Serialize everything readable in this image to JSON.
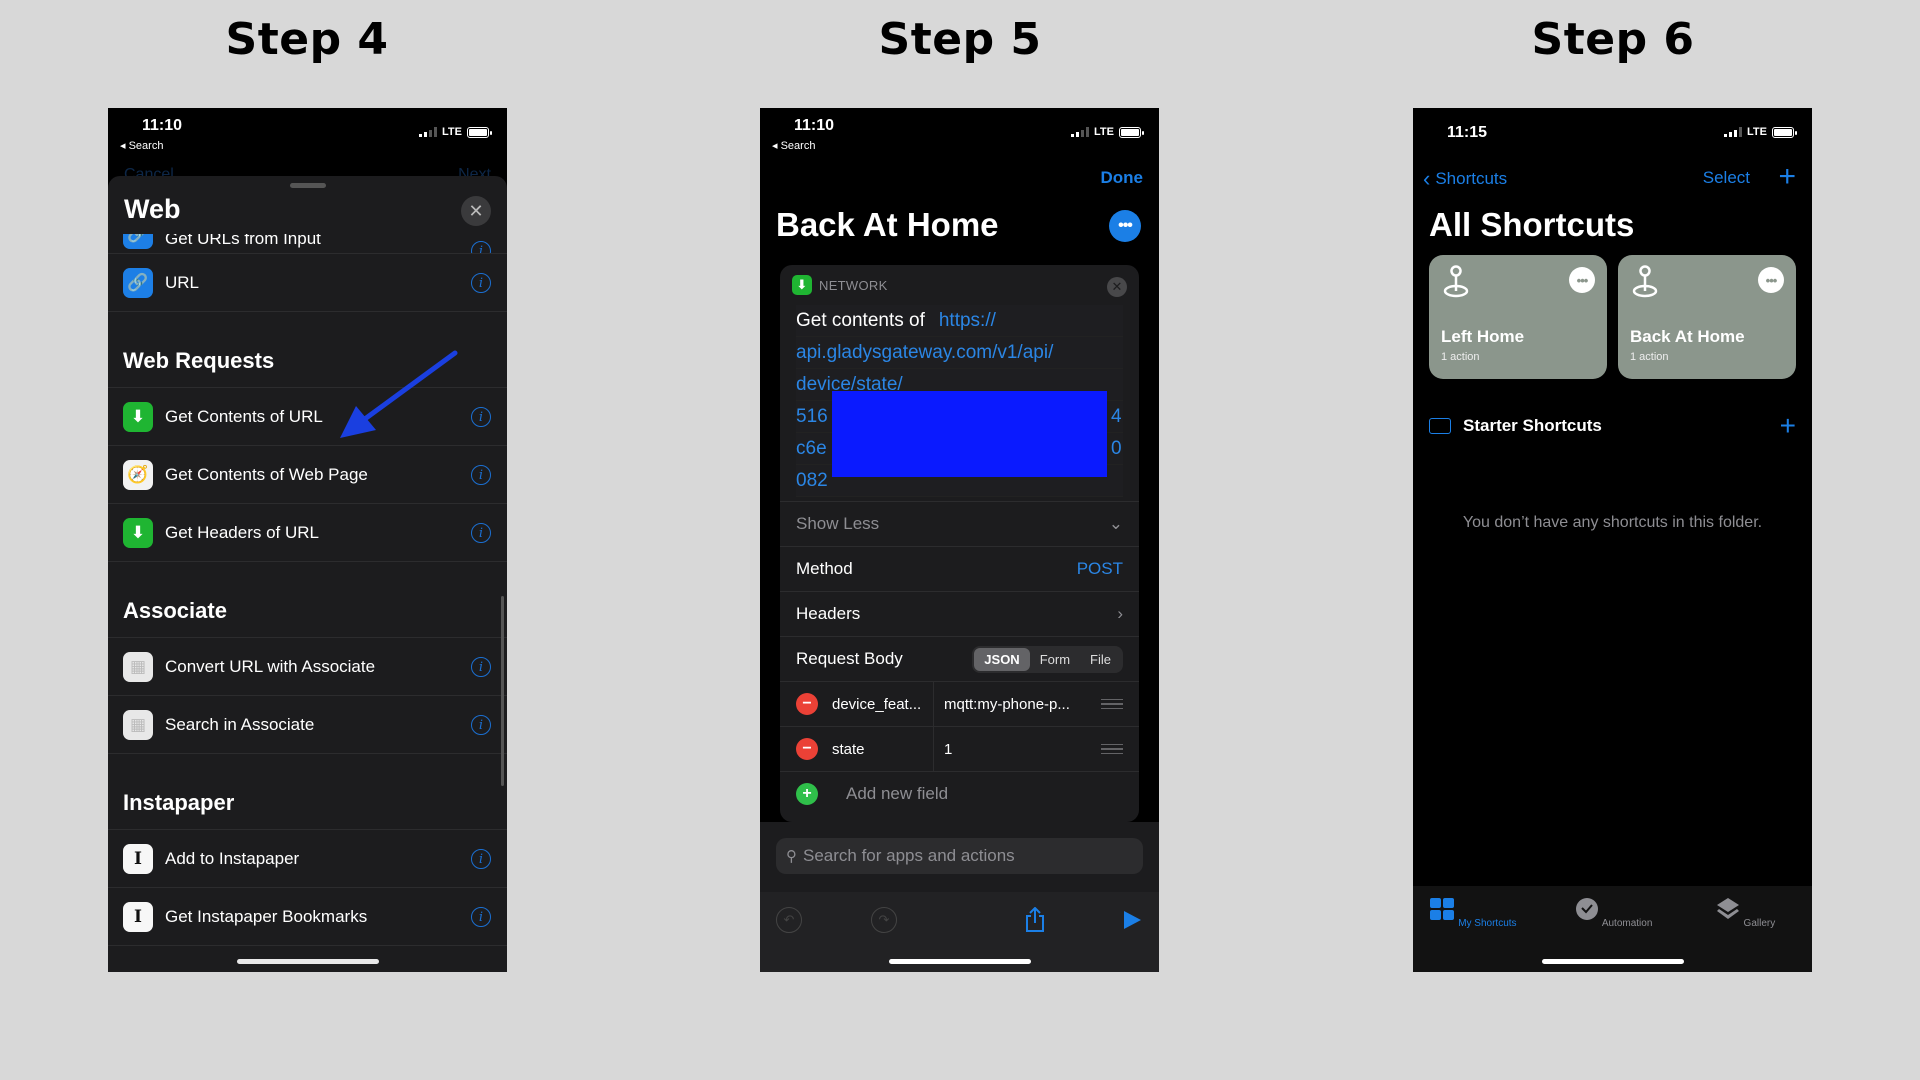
{
  "steps": [
    {
      "title": "Step 4"
    },
    {
      "title": "Step 5"
    },
    {
      "title": "Step 6"
    }
  ],
  "colors": {
    "background": "#d8d8d8",
    "accent_blue": "#1b7fe6",
    "annotation_arrow": "#1a3fe0",
    "redaction": "#0a1aff",
    "tile_bg": "#8b968c"
  },
  "step4": {
    "status": {
      "time": "11:10",
      "back": "◂ Search",
      "carrier": "LTE"
    },
    "ghost_nav": {
      "left": "Cancel",
      "right": "Next"
    },
    "sheet_title": "Web",
    "close_icon": "✕",
    "sections": [
      {
        "header": "",
        "items": [
          {
            "label": "Get URLs from Input",
            "icon": "link-icon"
          },
          {
            "label": "URL",
            "icon": "link-icon"
          }
        ]
      },
      {
        "header": "Web Requests",
        "items": [
          {
            "label": "Get Contents of URL",
            "icon": "download-arrow-icon",
            "highlighted": true
          },
          {
            "label": "Get Contents of Web Page",
            "icon": "safari-icon"
          },
          {
            "label": "Get Headers of URL",
            "icon": "download-arrow-icon"
          }
        ]
      },
      {
        "header": "Associate",
        "items": [
          {
            "label": "Convert URL with Associate",
            "icon": "associate-app-icon"
          },
          {
            "label": "Search in Associate",
            "icon": "associate-app-icon"
          }
        ]
      },
      {
        "header": "Instapaper",
        "items": [
          {
            "label": "Add to Instapaper",
            "icon": "instapaper-icon"
          },
          {
            "label": "Get Instapaper Bookmarks",
            "icon": "instapaper-icon"
          }
        ]
      }
    ]
  },
  "step5": {
    "status": {
      "time": "11:10",
      "back": "◂ Search",
      "carrier": "LTE"
    },
    "done_label": "Done",
    "shortcut_title": "Back At Home",
    "action": {
      "category": "NETWORK",
      "prefix": "Get contents of",
      "url_lines": [
        "https://",
        "api.gladysgateway.com/v1/api/",
        "device/state/",
        "516",
        "c6e",
        "082"
      ],
      "url_line_tails": [
        "",
        "",
        "",
        "4",
        "0",
        ""
      ],
      "show_less": "Show Less",
      "method_label": "Method",
      "method_value": "POST",
      "headers_label": "Headers",
      "body_label": "Request Body",
      "body_types": [
        "JSON",
        "Form",
        "File"
      ],
      "body_selected": "JSON",
      "fields": [
        {
          "key": "device_feat...",
          "value": "mqtt:my-phone-p..."
        },
        {
          "key": "state",
          "value": "1"
        }
      ],
      "add_field": "Add new field"
    },
    "search_placeholder": "Search for apps and actions"
  },
  "step6": {
    "status": {
      "time": "11:15",
      "carrier": "LTE"
    },
    "back_label": "Shortcuts",
    "select_label": "Select",
    "title": "All Shortcuts",
    "shortcuts": [
      {
        "name": "Left Home",
        "subtitle": "1 action"
      },
      {
        "name": "Back At Home",
        "subtitle": "1 action"
      }
    ],
    "folder_label": "Starter Shortcuts",
    "empty_message": "You don’t have any shortcuts in this folder.",
    "tabs": [
      {
        "label": "My Shortcuts",
        "active": true
      },
      {
        "label": "Automation",
        "active": false
      },
      {
        "label": "Gallery",
        "active": false
      }
    ]
  }
}
